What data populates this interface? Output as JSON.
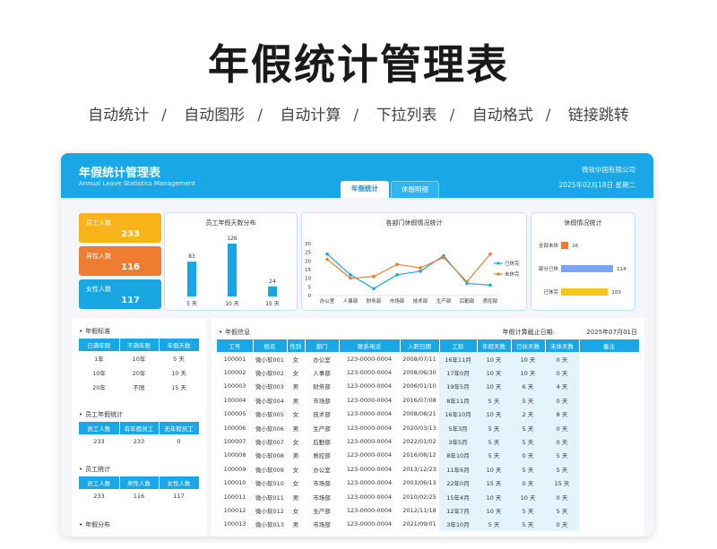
{
  "hero": {
    "title": "年假统计管理表",
    "features": [
      "自动统计",
      "自动图形",
      "自动计算",
      "下拉列表",
      "自动格式",
      "链接跳转"
    ],
    "separator": "/"
  },
  "panel": {
    "title": "年假统计管理表",
    "subtitle": "Annual Leave Statistics Management",
    "company": "微软中国有限公司",
    "date": "2025年02月18日 星期二",
    "tabs": [
      "年假统计",
      "休假明细"
    ]
  },
  "kpis": [
    {
      "label": "员工人数",
      "value": "233"
    },
    {
      "label": "男性人数",
      "value": "116"
    },
    {
      "label": "女性人数",
      "value": "117"
    }
  ],
  "chart_data": [
    {
      "type": "bar",
      "title": "员工年假天数分布",
      "categories": [
        "5 天",
        "10 天",
        "15 天"
      ],
      "values": [
        83,
        126,
        24
      ],
      "color": "#19a7e2"
    },
    {
      "type": "line",
      "title": "各部门休假情况统计",
      "categories": [
        "办公室",
        "人事部",
        "财务部",
        "市场部",
        "技术部",
        "生产部",
        "后勤部",
        "质控部"
      ],
      "ylim": [
        0,
        30
      ],
      "yticks": [
        0,
        5,
        10,
        15,
        20,
        25,
        30
      ],
      "series": [
        {
          "name": "已休完",
          "values": [
            24,
            12,
            4,
            12,
            14,
            23,
            7,
            6
          ],
          "color": "#19a7e2"
        },
        {
          "name": "未休完",
          "values": [
            21,
            10,
            11,
            18,
            16,
            22,
            8,
            24
          ],
          "color": "#ef7d31"
        }
      ],
      "legend": "right"
    },
    {
      "type": "bar",
      "orientation": "horizontal",
      "title": "休假情况统计",
      "categories": [
        "全部未休",
        "部分已休",
        "已休完"
      ],
      "values": [
        16,
        114,
        103
      ],
      "colors": [
        "#ef7d31",
        "#7ea4f5",
        "#fbc41c"
      ]
    }
  ],
  "left": {
    "standard": {
      "title": "年假标准",
      "headers": [
        "已满年限",
        "不满年限",
        "年假天数"
      ],
      "rows": [
        [
          "1年",
          "10年",
          "5 天"
        ],
        [
          "10年",
          "20年",
          "10 天"
        ],
        [
          "20年",
          "不限",
          "15 天"
        ]
      ]
    },
    "leave_stats": {
      "title": "员工年假统计",
      "headers": [
        "员工人数",
        "有年假员工",
        "无年假员工"
      ],
      "rows": [
        [
          "233",
          "233",
          "0"
        ]
      ]
    },
    "staff_stats": {
      "title": "员工统计",
      "headers": [
        "员工人数",
        "男性人数",
        "女性人数"
      ],
      "rows": [
        [
          "233",
          "116",
          "117"
        ]
      ]
    },
    "distribution_title": "年假分布"
  },
  "info": {
    "title": "年假信息",
    "date_label": "年假计算截止日期:",
    "date_value": "2025年07月01日",
    "headers": [
      "工号",
      "姓名",
      "性别",
      "部门",
      "联系电话",
      "入职日期",
      "工龄",
      "年假天数",
      "已休天数",
      "未休天数",
      "备注"
    ],
    "rows": [
      [
        "100001",
        "微小软001",
        "女",
        "办公室",
        "123-0000-0004",
        "2008/07/11",
        "16年11月",
        "10 天",
        "10 天",
        "0 天",
        ""
      ],
      [
        "100002",
        "微小软002",
        "女",
        "人事部",
        "123-0000-0004",
        "2008/06/30",
        "17年0月",
        "10 天",
        "10 天",
        "0 天",
        ""
      ],
      [
        "100003",
        "微小软003",
        "男",
        "财务部",
        "123-0000-0004",
        "2006/01/10",
        "19年5月",
        "10 天",
        "6 天",
        "4 天",
        ""
      ],
      [
        "100004",
        "微小软004",
        "男",
        "市场部",
        "123-0000-0004",
        "2016/07/08",
        "8年11月",
        "5 天",
        "5 天",
        "0 天",
        ""
      ],
      [
        "100005",
        "微小软005",
        "女",
        "技术部",
        "123-0000-0004",
        "2008/08/21",
        "16年10月",
        "10 天",
        "2 天",
        "8 天",
        ""
      ],
      [
        "100006",
        "微小软006",
        "男",
        "生产部",
        "123-0000-0004",
        "2020/03/13",
        "5年3月",
        "5 天",
        "5 天",
        "0 天",
        ""
      ],
      [
        "100007",
        "微小软007",
        "女",
        "后勤部",
        "123-0000-0004",
        "2022/01/02",
        "3年5月",
        "5 天",
        "5 天",
        "0 天",
        ""
      ],
      [
        "100008",
        "微小软008",
        "男",
        "质控部",
        "123-0000-0004",
        "2016/08/12",
        "8年10月",
        "5 天",
        "0 天",
        "5 天",
        ""
      ],
      [
        "100009",
        "微小软009",
        "女",
        "办公室",
        "123-0000-0004",
        "2013/12/23",
        "11年6月",
        "10 天",
        "5 天",
        "5 天",
        ""
      ],
      [
        "100010",
        "微小软010",
        "女",
        "市场部",
        "123-0000-0004",
        "2003/06/13",
        "22年0月",
        "15 天",
        "0 天",
        "15 天",
        ""
      ],
      [
        "100011",
        "微小软011",
        "男",
        "市场部",
        "123-0000-0004",
        "2010/02/25",
        "15年4月",
        "10 天",
        "10 天",
        "0 天",
        ""
      ],
      [
        "100012",
        "微小软012",
        "女",
        "生产部",
        "123-0000-0004",
        "2012/11/18",
        "12年7月",
        "10 天",
        "5 天",
        "5 天",
        ""
      ],
      [
        "100013",
        "微小软013",
        "男",
        "市场部",
        "123-0000-0004",
        "2021/09/01",
        "3年10月",
        "5 天",
        "5 天",
        "0 天",
        ""
      ]
    ]
  }
}
